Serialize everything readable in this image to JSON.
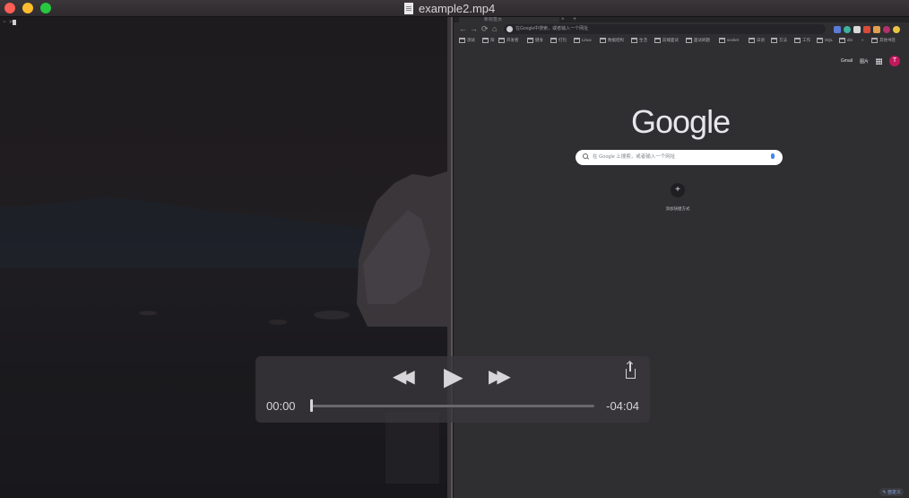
{
  "window": {
    "title": "example2.mp4"
  },
  "terminal": {
    "prompt": "~ >"
  },
  "browser": {
    "tab_title": "新标签页",
    "tab_close": "×",
    "new_tab": "+",
    "nav": {
      "back": "←",
      "forward": "→",
      "reload": "⟳",
      "home": "⌂"
    },
    "omnibox_placeholder": "在Google中搜索，或者输入一个网址",
    "bookmarks": [
      "测试",
      "阳",
      "开发者",
      "健身",
      "打包",
      "Linux",
      "数据结构",
      "生活",
      "前端面试",
      "面试刷题",
      "socket",
      "日语",
      "方法",
      "工作",
      "SQL",
      "dm",
      "»",
      "其他书签"
    ],
    "top_links": {
      "gmail": "Gmail",
      "images": "图片",
      "account_initial": "T"
    },
    "logo": "Google",
    "search_placeholder": "在 Google 上搜索，或者输入一个网址",
    "add_shortcut_label": "添加快捷方式",
    "add_shortcut_symbol": "+",
    "customize": "自定义",
    "colors": {
      "logo": "#e8e6ea",
      "account": "#c2185b",
      "accent": "#8ab4f8"
    }
  },
  "player": {
    "rewind_icon": "◀◀",
    "play_icon": "▶",
    "forward_icon": "▶▶",
    "elapsed": "00:00",
    "remaining": "-04:04",
    "progress_fraction": 0.0
  }
}
